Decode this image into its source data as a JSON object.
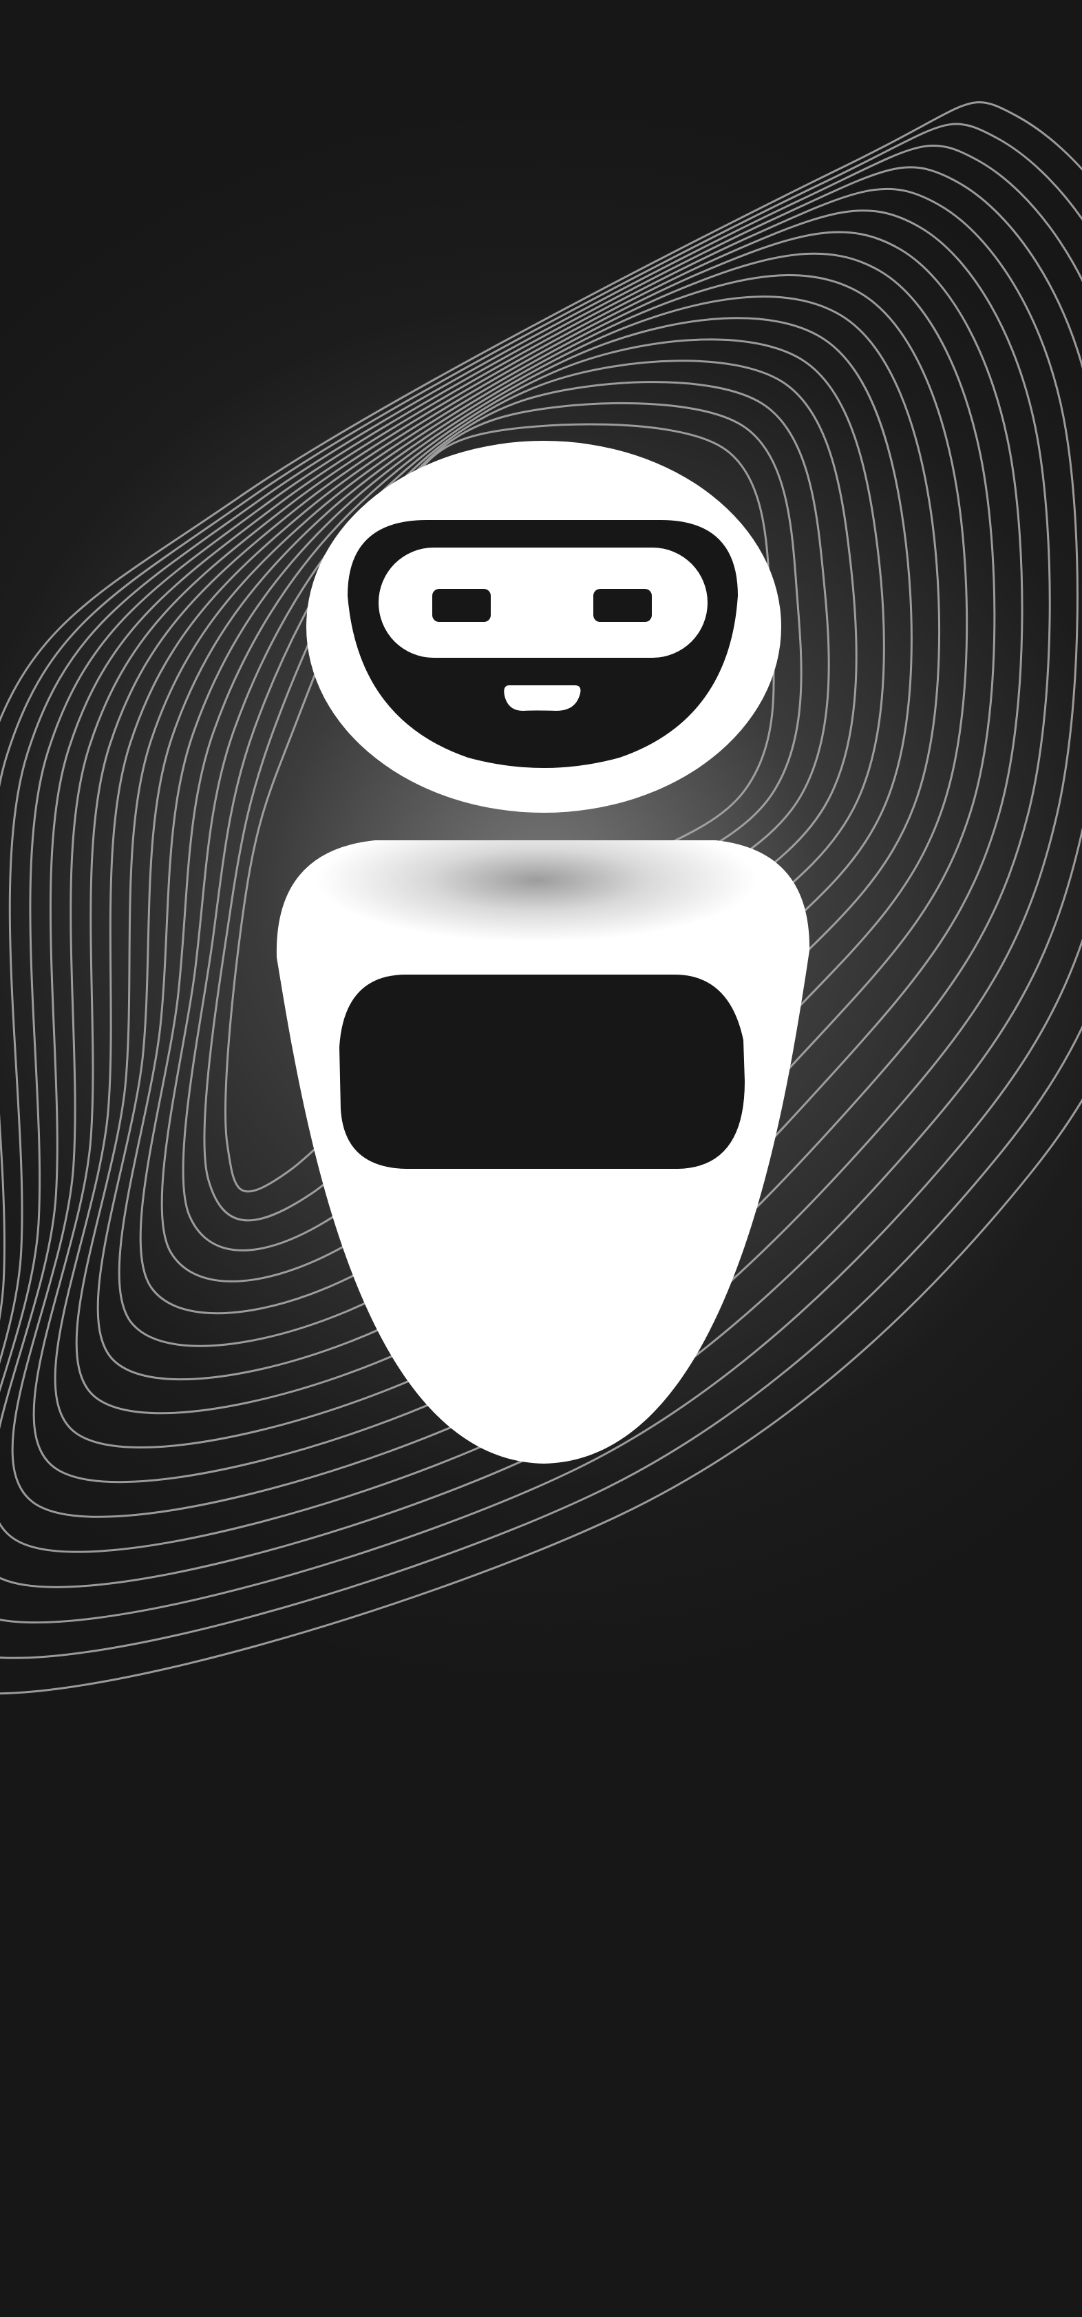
{
  "scene": {
    "subject": "robot-mascot",
    "colors": {
      "background": "#171717",
      "glow": "#7a7a7a",
      "contour_lines": "#a9a9a9",
      "robot_body": "#ffffff",
      "robot_features": "#171717"
    },
    "icons": [
      "robot-head-icon",
      "robot-eye-icon",
      "robot-mouth-icon",
      "robot-body-icon",
      "robot-chest-screen-icon"
    ]
  }
}
